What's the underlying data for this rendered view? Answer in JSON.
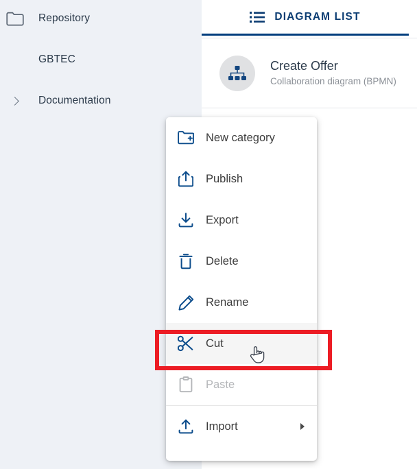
{
  "tree": {
    "items": [
      {
        "label": "Repository",
        "icon": "folder-icon",
        "has_chevron": false
      },
      {
        "label": "GBTEC",
        "icon": "",
        "has_chevron": false
      },
      {
        "label": "Documentation",
        "icon": "",
        "has_chevron": true
      }
    ]
  },
  "content": {
    "tab": {
      "label": "DIAGRAM LIST",
      "icon": "list-icon",
      "active_underline_color": "#003d7d"
    },
    "diagram": {
      "title": "Create Offer",
      "subtitle": "Collaboration diagram (BPMN)",
      "icon": "hierarchy-diagram-icon"
    }
  },
  "context_menu": {
    "items": [
      {
        "label": "New category",
        "icon": "new-folder-icon",
        "disabled": false,
        "highlighted": false,
        "submenu": false
      },
      {
        "label": "Publish",
        "icon": "publish-upload-icon",
        "disabled": false,
        "highlighted": false,
        "submenu": false
      },
      {
        "label": "Export",
        "icon": "export-download-icon",
        "disabled": false,
        "highlighted": false,
        "submenu": false
      },
      {
        "label": "Delete",
        "icon": "trash-icon",
        "disabled": false,
        "highlighted": false,
        "submenu": false
      },
      {
        "label": "Rename",
        "icon": "pencil-icon",
        "disabled": false,
        "highlighted": false,
        "submenu": false
      },
      {
        "label": "Cut",
        "icon": "scissors-icon",
        "disabled": false,
        "highlighted": true,
        "submenu": false
      },
      {
        "label": "Paste",
        "icon": "clipboard-icon",
        "disabled": true,
        "highlighted": false,
        "submenu": false
      },
      {
        "label": "Import",
        "icon": "import-upload-icon",
        "disabled": false,
        "highlighted": false,
        "submenu": true
      }
    ]
  },
  "annotation": {
    "target_label": "Cut",
    "color": "#ec1c24"
  },
  "cursor": {
    "type": "pointing-hand-cursor"
  },
  "colors": {
    "sidebar_background": "#eef1f6",
    "content_background": "#ffffff",
    "brand_blue": "#0b3c72",
    "icon_blue": "#0d4d8c",
    "disabled_gray": "#b4b6b9"
  }
}
